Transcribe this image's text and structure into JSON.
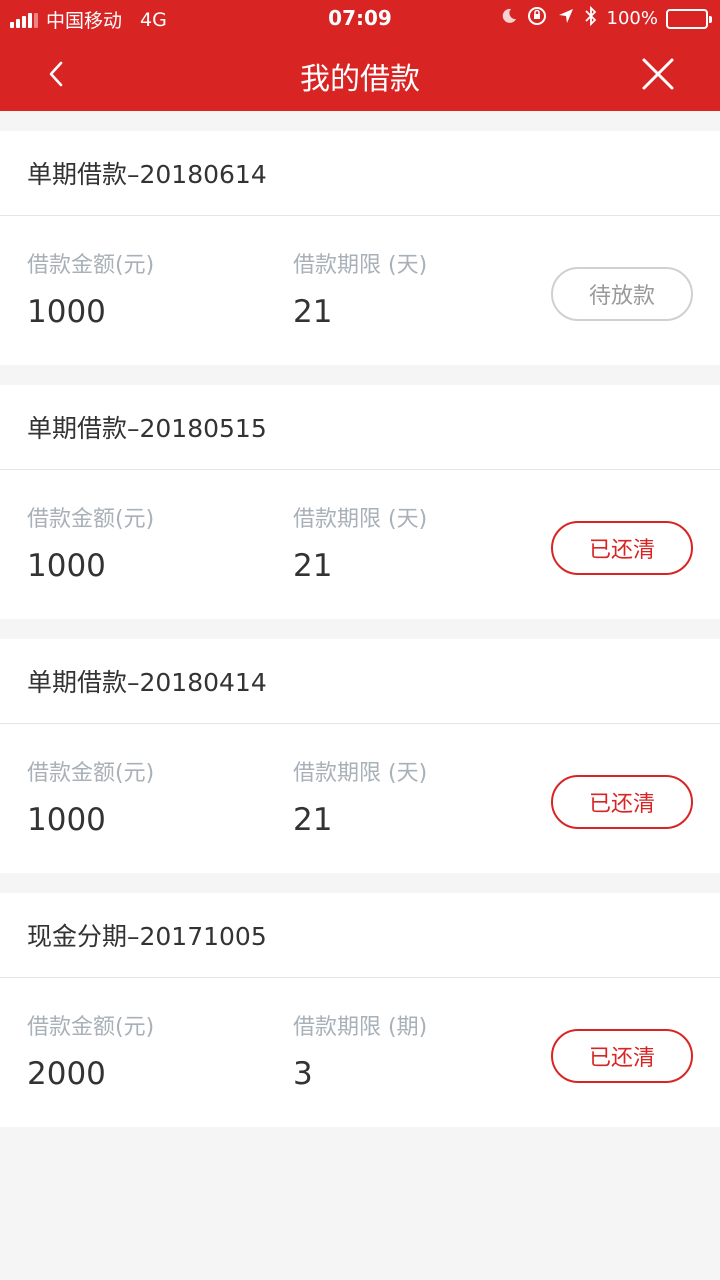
{
  "status_bar": {
    "carrier": "中国移动",
    "network": "4G",
    "time": "07:09",
    "battery": "100%",
    "icons": [
      "moon-icon",
      "orientation-lock-icon",
      "location-arrow-icon",
      "bluetooth-icon",
      "battery-icon"
    ]
  },
  "header": {
    "title": "我的借款",
    "back_icon": "chevron-left-icon",
    "close_icon": "close-icon",
    "color": "#d92424"
  },
  "loans": [
    {
      "title": "单期借款–20180614",
      "amount_label": "借款金额(元)",
      "amount": "1000",
      "term_label": "借款期限 (天)",
      "term": "21",
      "status": "待放款",
      "status_type": "pending"
    },
    {
      "title": "单期借款–20180515",
      "amount_label": "借款金额(元)",
      "amount": "1000",
      "term_label": "借款期限 (天)",
      "term": "21",
      "status": "已还清",
      "status_type": "cleared"
    },
    {
      "title": "单期借款–20180414",
      "amount_label": "借款金额(元)",
      "amount": "1000",
      "term_label": "借款期限 (天)",
      "term": "21",
      "status": "已还清",
      "status_type": "cleared"
    },
    {
      "title": "现金分期–20171005",
      "amount_label": "借款金额(元)",
      "amount": "2000",
      "term_label": "借款期限 (期)",
      "term": "3",
      "status": "已还清",
      "status_type": "cleared"
    }
  ]
}
